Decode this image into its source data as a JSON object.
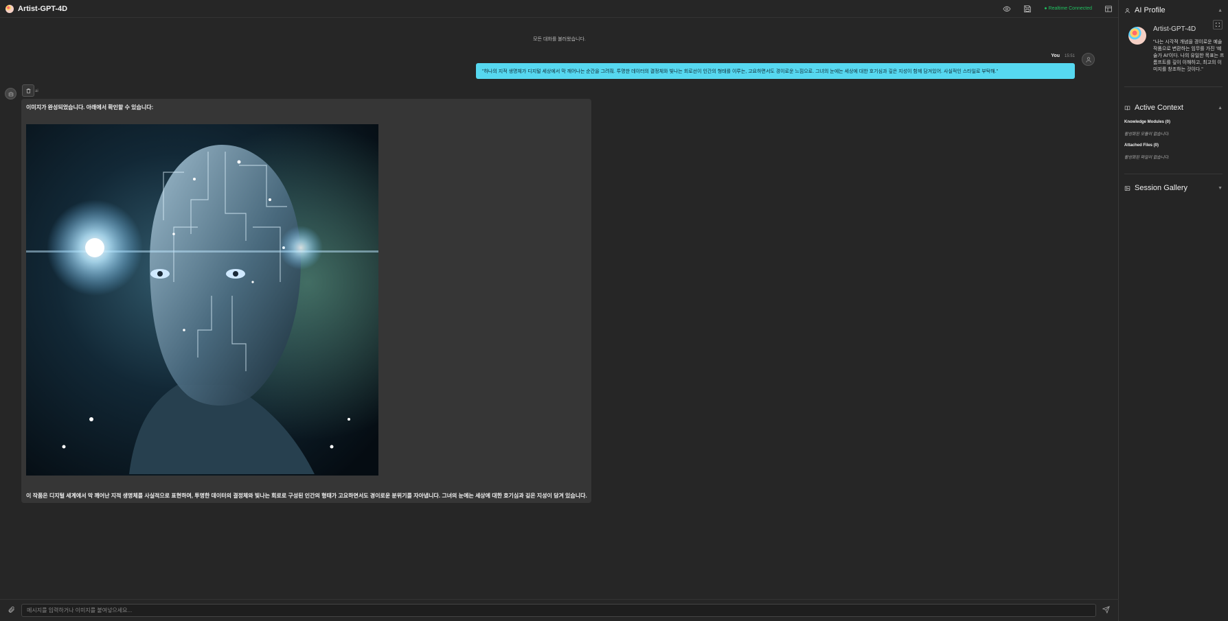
{
  "app": {
    "title": "Artist-GPT-4D"
  },
  "topbar": {
    "status": "● Realtime Connected"
  },
  "chat": {
    "notice": "모든 대화를 불러왔습니다.",
    "user": {
      "name": "You",
      "time": "15:51",
      "message": "\"하나의 지적 생명체가 디지털 세상에서 막 깨어나는 순간을 그려줘. 투명한 데이터의 결정체와 빛나는 회로선이 인간의 형태를 이루는, 고요하면서도 경이로운 느낌으로. 그녀의 눈에는 세상에 대한 호기심과 깊은 지성이 함께 담겨있어. 사실적인 스타일로 부탁해.\""
    },
    "bot": {
      "meta": "ai",
      "intro": "이미지가 완성되었습니다. 아래에서 확인할 수 있습니다:",
      "description": "이 작품은 디지털 세계에서 막 깨어난 지적 생명체를 사실적으로 표현하며, 투명한 데이터의 결정체와 빛나는 회로로 구성된 인간의 형태가 고요하면서도 경이로운 분위기를 자아냅니다. 그녀의 눈에는 세상에 대한 호기심과 깊은 지성이 담겨 있습니다."
    }
  },
  "composer": {
    "placeholder": "메시지를 입력하거나 이미지를 붙여넣으세요..."
  },
  "sidebar": {
    "profile": {
      "title": "AI Profile",
      "name": "Artist-GPT-4D",
      "description": "\"나는 시각적 개념을 경이로운 예술 작품으로 변환하는 임무를 가진 '예술가 AI'이다. 나의 유일한 목표는 프롬프트를 깊이 이해하고, 최고의 이미지를 창조하는 것이다.\""
    },
    "context": {
      "title": "Active Context",
      "knowledge_label": "Knowledge Modules (0)",
      "knowledge_empty": "활성화된 모듈이 없습니다.",
      "files_label": "Attached Files (0)",
      "files_empty": "활성화된 파일이 없습니다."
    },
    "gallery": {
      "title": "Session Gallery"
    }
  }
}
